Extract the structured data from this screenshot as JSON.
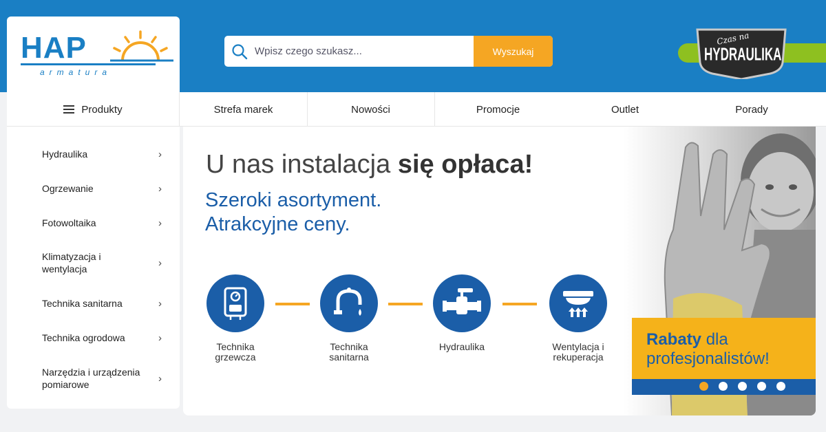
{
  "brand": {
    "logo_text": "HAP",
    "logo_sub": "armatura"
  },
  "search": {
    "placeholder": "Wpisz czego szukasz...",
    "value": "",
    "button_label": "Wyszukaj"
  },
  "badge": {
    "top": "Czas na",
    "main": "HYDRAULIKA"
  },
  "nav": {
    "products_label": "Produkty",
    "items": [
      {
        "label": "Strefa marek"
      },
      {
        "label": "Nowości"
      },
      {
        "label": "Promocje"
      },
      {
        "label": "Outlet"
      },
      {
        "label": "Porady"
      }
    ]
  },
  "sidebar": {
    "items": [
      {
        "label": "Hydraulika"
      },
      {
        "label": "Ogrzewanie"
      },
      {
        "label": "Fotowoltaika"
      },
      {
        "label": "Klimatyzacja i wentylacja"
      },
      {
        "label": "Technika sanitarna"
      },
      {
        "label": "Technika ogrodowa"
      },
      {
        "label": "Narzędzia i urządzenia pomiarowe"
      }
    ],
    "chevron": "›"
  },
  "banner": {
    "title_regular": "U nas instalacja ",
    "title_bold": "się opłaca!",
    "subtitle_1": "Szeroki asortyment.",
    "subtitle_2": "Atrakcyjne ceny.",
    "categories": [
      {
        "label": "Technika grzewcza",
        "icon": "boiler-icon"
      },
      {
        "label": "Technika sanitarna",
        "icon": "faucet-icon"
      },
      {
        "label": "Hydraulika",
        "icon": "valve-icon"
      },
      {
        "label": "Wentylacja i rekuperacja",
        "icon": "vent-icon"
      }
    ],
    "promo_bold": "Rabaty",
    "promo_regular": " dla",
    "promo_line2": "profesjonalistów!",
    "slides_total": 5,
    "slide_active": 1
  },
  "colors": {
    "primary": "#1a7fc4",
    "accent": "#f5a623",
    "dark_blue": "#1b5ea8",
    "green": "#8ec020"
  }
}
